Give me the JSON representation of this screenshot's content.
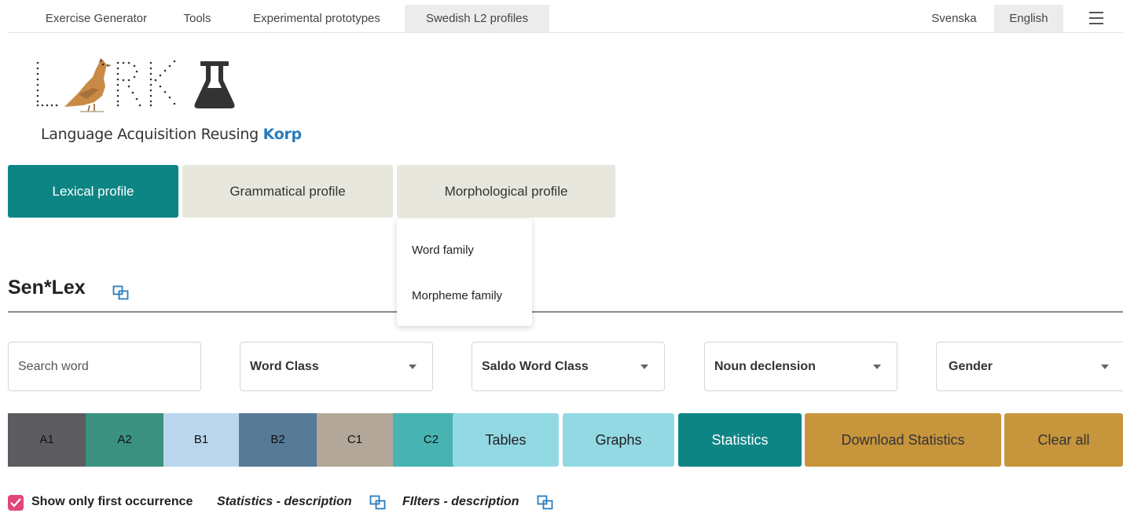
{
  "nav": {
    "items": [
      {
        "label": "Exercise Generator",
        "active": false
      },
      {
        "label": "Tools",
        "active": false
      },
      {
        "label": "Experimental prototypes",
        "active": false
      },
      {
        "label": "Swedish L2 profiles",
        "active": true
      }
    ],
    "lang": [
      {
        "label": "Svenska",
        "active": false
      },
      {
        "label": "English",
        "active": true
      }
    ],
    "menu_icon": "hamburger-icon"
  },
  "logo": {
    "text": "LARK",
    "tagline_prefix": "Language Acquisition Reusing ",
    "tagline_highlight": "Korp",
    "icon": "flask-icon"
  },
  "profile_tabs": [
    {
      "label": "Lexical profile",
      "active": true
    },
    {
      "label": "Grammatical profile",
      "active": false
    },
    {
      "label": "Morphological profile",
      "active": false
    }
  ],
  "morph_menu": [
    "Word family",
    "Morpheme family"
  ],
  "section": {
    "title": "Sen*Lex",
    "icon": "external-link-icon"
  },
  "filters": {
    "search_placeholder": "Search word",
    "search_value": "",
    "selects": [
      "Word Class",
      "Saldo Word Class",
      "Noun declension",
      "Gender"
    ]
  },
  "levels": [
    {
      "label": "A1",
      "color": "#5c5b60"
    },
    {
      "label": "A2",
      "color": "#3a9180"
    },
    {
      "label": "B1",
      "color": "#b9d6ec"
    },
    {
      "label": "B2",
      "color": "#577a96"
    },
    {
      "label": "C1",
      "color": "#b3a79a"
    },
    {
      "label": "C2",
      "color": "#47b3b3"
    }
  ],
  "buttons": [
    {
      "label": "Tables",
      "bg": "#93d9e4",
      "fg": "#222222"
    },
    {
      "label": "Graphs",
      "bg": "#93d9e4",
      "fg": "#222222"
    },
    {
      "label": "Statistics",
      "bg": "#0e8585",
      "fg": "#ffffff"
    },
    {
      "label": "Download Statistics",
      "bg": "#c7953c",
      "fg": "#333333"
    },
    {
      "label": "Clear all",
      "bg": "#c7953c",
      "fg": "#333333"
    }
  ],
  "options": {
    "show_first_label": "Show only first occurrence",
    "show_first_checked": true,
    "statistics_desc": "Statistics - description",
    "filters_desc": "FIlters - description"
  },
  "colors": {
    "accent": "#0e8585",
    "link": "#2a7bbd",
    "checkbox": "#e0457b"
  }
}
